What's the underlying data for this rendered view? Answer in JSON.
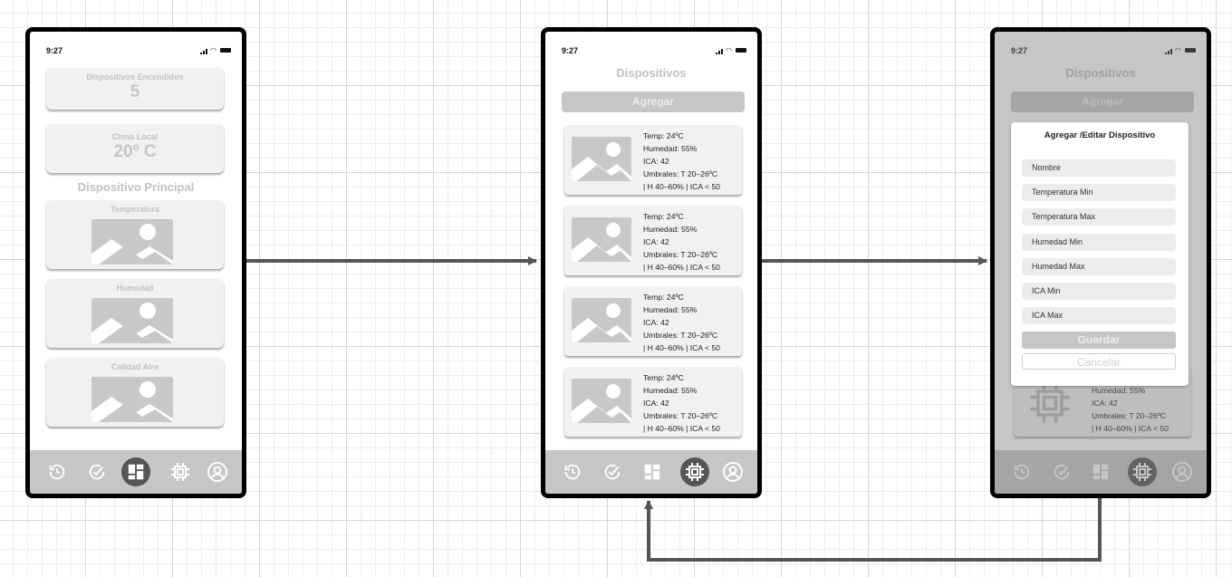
{
  "status": {
    "time": "9:27"
  },
  "screen1": {
    "devices_on_label": "Dispositivos Encendidos",
    "devices_on_value": "5",
    "weather_label": "Clima Local",
    "weather_value": "20º C",
    "main_device_title": "Dispositivo Principal",
    "cards": [
      {
        "label": "Temperatura"
      },
      {
        "label": "Humedad"
      },
      {
        "label": "Calidad Aire"
      }
    ]
  },
  "screen2": {
    "title": "Dispositivos",
    "add_label": "Agregar",
    "devices": [
      {
        "temp": "Temp: 24ºC",
        "humidity": "Humedad: 55%",
        "ica": "ICA: 42",
        "thresholds_1": "Umbrales: T 20–26ºC",
        "thresholds_2": "| H 40–60% | ICA < 50"
      },
      {
        "temp": "Temp: 24ºC",
        "humidity": "Humedad: 55%",
        "ica": "ICA: 42",
        "thresholds_1": "Umbrales: T 20–26ºC",
        "thresholds_2": "| H 40–60% | ICA < 50"
      },
      {
        "temp": "Temp: 24ºC",
        "humidity": "Humedad: 55%",
        "ica": "ICA: 42",
        "thresholds_1": "Umbrales: T 20–26ºC",
        "thresholds_2": "| H 40–60% | ICA < 50"
      },
      {
        "temp": "Temp: 24ºC",
        "humidity": "Humedad: 55%",
        "ica": "ICA: 42",
        "thresholds_1": "Umbrales: T 20–26ºC",
        "thresholds_2": "| H 40–60% | ICA < 50"
      }
    ]
  },
  "screen3": {
    "title": "Dispositivos",
    "add_label": "Agregar",
    "modal_title": "Agregar /Editar Dispositivo",
    "fields": [
      {
        "label": "Nombre"
      },
      {
        "label": "Temperatura Min"
      },
      {
        "label": "Temperatura Max"
      },
      {
        "label": "Humedad Min"
      },
      {
        "label": "Humedad Max"
      },
      {
        "label": "ICA Min"
      },
      {
        "label": "ICA Max"
      }
    ],
    "save_label": "Guardar",
    "cancel_label": "Cancelar",
    "bg_device": {
      "humidity": "Humedad: 55%",
      "ica": "ICA: 42",
      "thresholds_1": "Umbrales: T 20–26ºC",
      "thresholds_2": "| H 40–60% | ICA < 50"
    }
  },
  "nav_icons": [
    "history-icon",
    "check-circle-icon",
    "dashboard-icon",
    "chip-icon",
    "user-icon"
  ],
  "colors": {
    "frame": "#000000",
    "active_nav": "#555555",
    "nav_bg": "#c6c6c6",
    "card_bg": "#f1f1f1",
    "arrow": "#555555"
  }
}
